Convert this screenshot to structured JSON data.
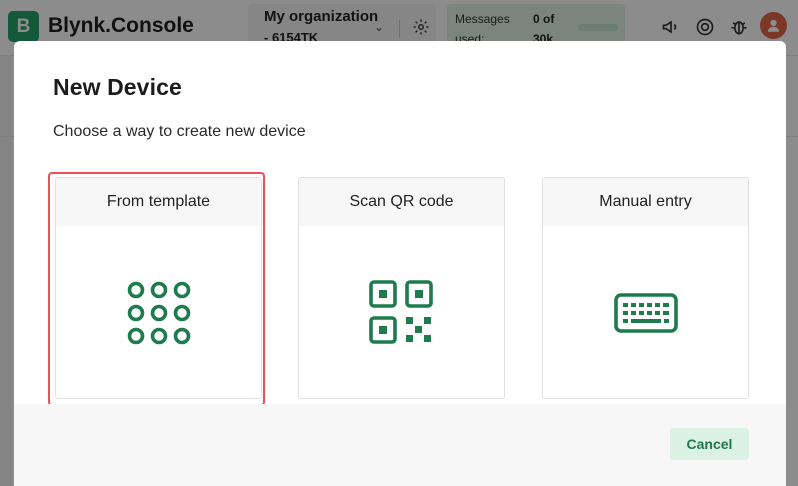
{
  "app": {
    "brand_letter": "B",
    "brand_name": "Blynk.Console",
    "org_name": "My organization",
    "org_id": "- 6154TK",
    "messages_label_1": "Messages",
    "messages_label_2": "used:",
    "messages_value_1": "0 of",
    "messages_value_2": "30k",
    "icons": [
      "gear-icon",
      "megaphone-icon",
      "lifebuoy-icon",
      "bug-icon",
      "avatar"
    ]
  },
  "modal": {
    "title": "New Device",
    "subtitle": "Choose a way to create new device",
    "options": [
      {
        "label": "From template",
        "icon": "grid-icon",
        "selected": true
      },
      {
        "label": "Scan QR code",
        "icon": "qr-code-icon",
        "selected": false
      },
      {
        "label": "Manual entry",
        "icon": "keyboard-icon",
        "selected": false
      }
    ],
    "cancel_label": "Cancel"
  },
  "colors": {
    "accent": "#1f7a4e",
    "highlight": "#ee4e5a",
    "cancel_bg": "#daf1e4"
  }
}
